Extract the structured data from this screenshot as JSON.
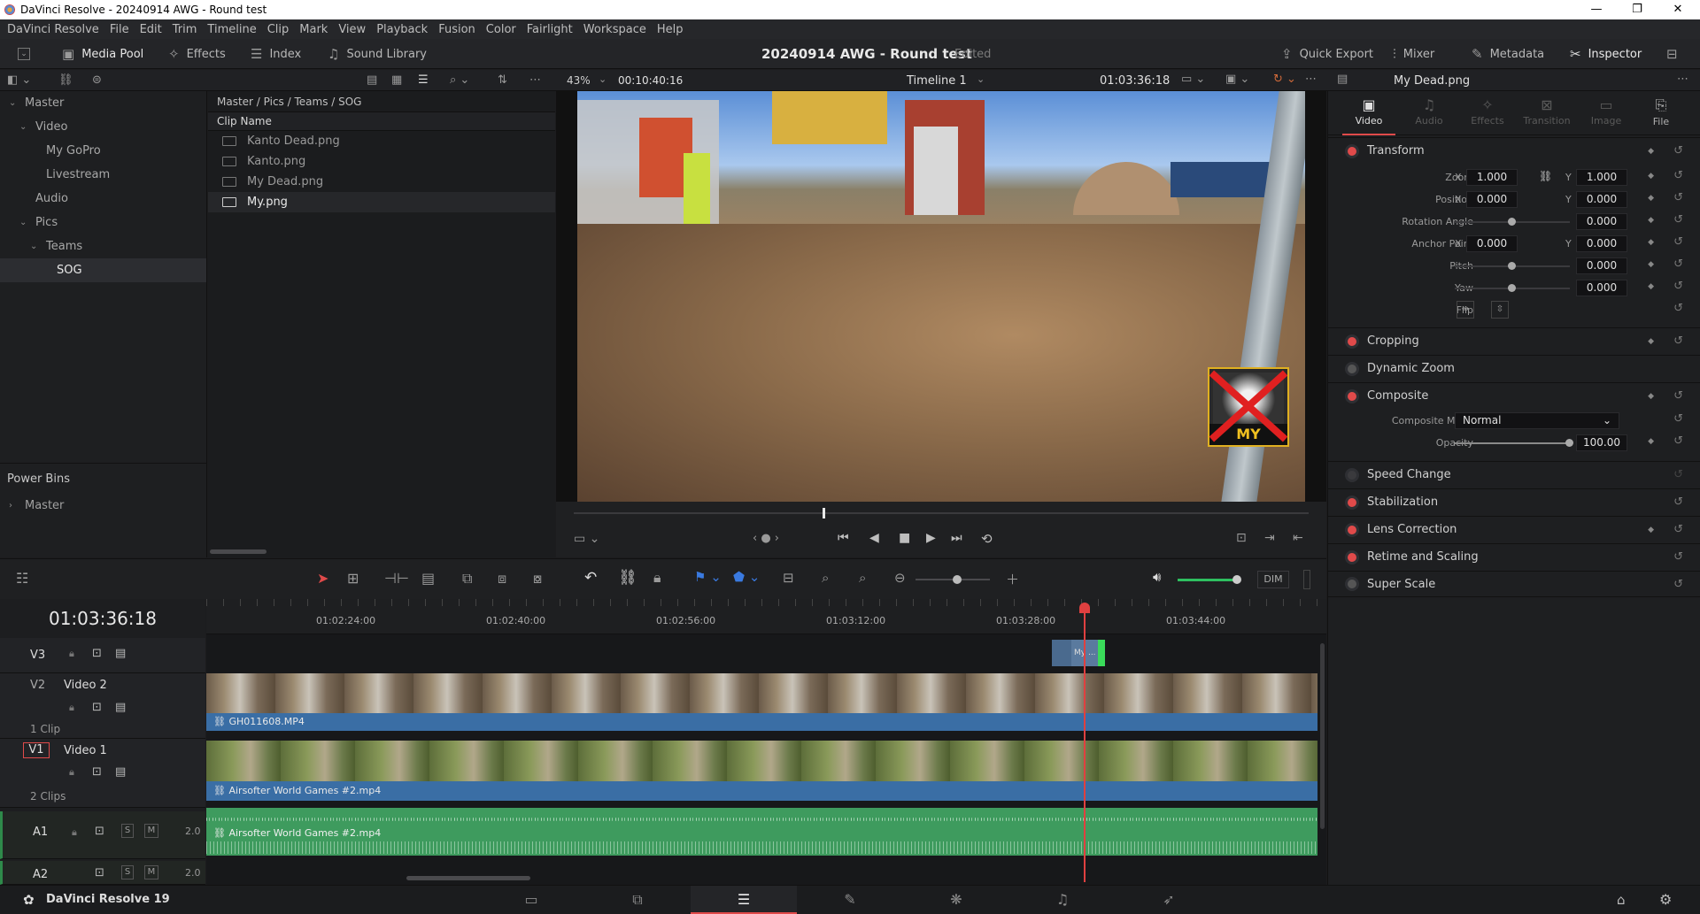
{
  "titlebar": {
    "title": "DaVinci Resolve - 20240914 AWG - Round test",
    "minimize": "—",
    "maximize": "❐",
    "close": "✕"
  },
  "menu": [
    "DaVinci Resolve",
    "File",
    "Edit",
    "Trim",
    "Timeline",
    "Clip",
    "Mark",
    "View",
    "Playback",
    "Fusion",
    "Color",
    "Fairlight",
    "Workspace",
    "Help"
  ],
  "toolbar": {
    "media_pool": "Media Pool",
    "effects": "Effects",
    "index": "Index",
    "sound_library": "Sound Library",
    "project_title": "20240914 AWG - Round test",
    "edited": "Edited",
    "quick_export": "Quick Export",
    "mixer": "Mixer",
    "metadata": "Metadata",
    "inspector": "Inspector"
  },
  "viewer_header": {
    "zoom": "43%",
    "source_tc": "00:10:40:16",
    "timeline": "Timeline 1",
    "record_tc": "01:03:36:18"
  },
  "bins": {
    "items": [
      "Master",
      "Video",
      "My GoPro",
      "Livestream",
      "Audio",
      "Pics",
      "Teams",
      "SOG"
    ],
    "selected": "SOG",
    "power_bins": "Power Bins",
    "power_master": "Master"
  },
  "clips": {
    "path": "Master / Pics / Teams / SOG",
    "column": "Clip Name",
    "items": [
      "Kanto Dead.png",
      "Kanto.png",
      "My Dead.png",
      "My.png"
    ]
  },
  "overlay": {
    "label": "MY"
  },
  "inspector": {
    "clip": "My Dead.png",
    "tabs": [
      "Video",
      "Audio",
      "Effects",
      "Transition",
      "Image",
      "File"
    ],
    "transform": "Transform",
    "zoom_label": "Zoom",
    "zoom_x": "1.000",
    "zoom_y": "1.000",
    "position_label": "Position",
    "pos_x": "0.000",
    "pos_y": "0.000",
    "rotation_label": "Rotation Angle",
    "rotation": "0.000",
    "anchor_label": "Anchor Point",
    "anchor_x": "0.000",
    "anchor_y": "0.000",
    "pitch_label": "Pitch",
    "pitch": "0.000",
    "yaw_label": "Yaw",
    "yaw": "0.000",
    "flip_label": "Flip",
    "x": "X",
    "y": "Y",
    "cropping": "Cropping",
    "dynamic_zoom": "Dynamic Zoom",
    "composite": "Composite",
    "composite_mode_label": "Composite Mode",
    "composite_mode": "Normal",
    "opacity_label": "Opacity",
    "opacity": "100.00",
    "speed_change": "Speed Change",
    "stabilization": "Stabilization",
    "lens_correction": "Lens Correction",
    "retime": "Retime and Scaling",
    "super_scale": "Super Scale"
  },
  "timeline": {
    "timecode": "01:03:36:18",
    "ruler": [
      "01:02:24:00",
      "01:02:40:00",
      "01:02:56:00",
      "01:03:12:00",
      "01:03:28:00",
      "01:03:44:00"
    ],
    "tracks": {
      "v3": "V3",
      "v2": "V2",
      "v2_name": "Video 2",
      "v2_count": "1 Clip",
      "v1": "V1",
      "v1_name": "Video 1",
      "v1_count": "2 Clips",
      "a1": "A1",
      "a1_level": "2.0",
      "a2": "A2",
      "a2_level": "2.0",
      "s": "S",
      "m": "M"
    },
    "clip_v3": "My ...",
    "clip_v2": "GH011608.MP4",
    "clip_v1": "Airsofter World Games #2.mp4",
    "clip_a1": "Airsofter World Games #2.mp4",
    "dim": "DIM"
  },
  "bottombar": {
    "app": "DaVinci Resolve 19"
  }
}
